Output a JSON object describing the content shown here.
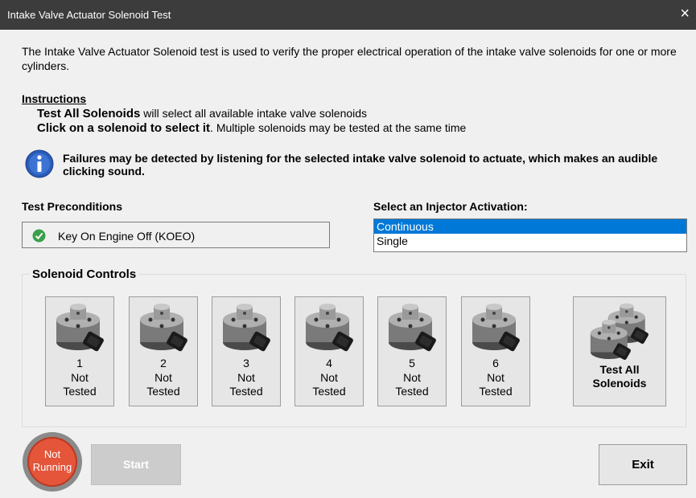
{
  "window": {
    "title": "Intake Valve Actuator Solenoid Test",
    "close_icon": "×"
  },
  "description": "The Intake Valve Actuator Solenoid test is used to verify the proper electrical operation of the intake valve solenoids for one or more cylinders.",
  "instructions": {
    "heading": "Instructions",
    "line1_bold": "Test All Solenoids",
    "line1_rest": " will select all available intake valve solenoids",
    "line2_bold": "Click on a solenoid to select it",
    "line2_rest": ". Multiple solenoids may be tested at the same time"
  },
  "info": {
    "icon": "info-icon",
    "text": "Failures may be detected by listening for the selected intake valve solenoid to actuate, which makes an audible clicking sound."
  },
  "preconditions": {
    "heading": "Test Preconditions",
    "item": "Key On Engine Off (KOEO)",
    "status_icon": "check-icon"
  },
  "activation": {
    "heading": "Select an Injector Activation:",
    "options": [
      "Continuous",
      "Single"
    ],
    "selected": "Continuous"
  },
  "solenoids": {
    "heading": "Solenoid Controls",
    "items": [
      {
        "number": "1",
        "status_line1": "Not",
        "status_line2": "Tested"
      },
      {
        "number": "2",
        "status_line1": "Not",
        "status_line2": "Tested"
      },
      {
        "number": "3",
        "status_line1": "Not",
        "status_line2": "Tested"
      },
      {
        "number": "4",
        "status_line1": "Not",
        "status_line2": "Tested"
      },
      {
        "number": "5",
        "status_line1": "Not",
        "status_line2": "Tested"
      },
      {
        "number": "6",
        "status_line1": "Not",
        "status_line2": "Tested"
      }
    ],
    "test_all_line1": "Test All",
    "test_all_line2": "Solenoids"
  },
  "footer": {
    "status_line1": "Not",
    "status_line2": "Running",
    "status_color": "#e4553a",
    "start_label": "Start",
    "exit_label": "Exit"
  }
}
